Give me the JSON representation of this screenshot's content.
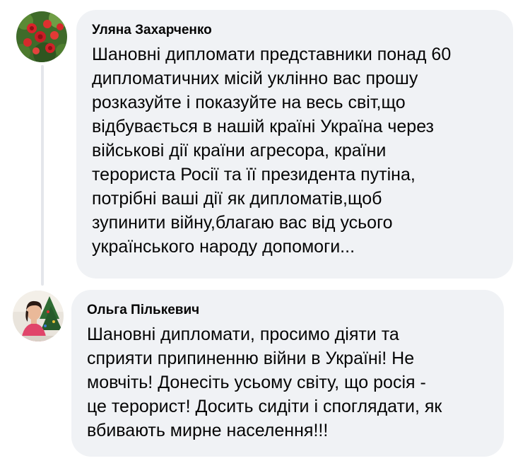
{
  "comments": [
    {
      "author": "Уляна Захарченко",
      "avatar_icon": "roses-photo-avatar",
      "lines": [
        "Шановні дипломати представники понад 60",
        "дипломатичних місій уклінно вас прошу",
        "розказуйте і показуйте на весь світ,що",
        "відбувається в нашій країні Україна через",
        "військові дії країни агресора, країни",
        "терориста Росії та її президента путіна,",
        "потрібні ваші дії як дипломатів,щоб",
        "зупинити війну,благаю вас від усього",
        "українського народу допомоги..."
      ]
    },
    {
      "author": "Ольга Пількевич",
      "avatar_icon": "woman-portrait-avatar",
      "lines": [
        "Шановні дипломати, просимо діяти та",
        "сприяти припиненню війни в Україні! Не",
        "мовчіть! Донесіть усьому світу, що росія -",
        "це терорист! Досить сидіти і споглядати, як",
        "вбивають мирне населення!!!"
      ]
    }
  ],
  "colors": {
    "bubble": "#f0f2f5",
    "text": "#050505",
    "thread_line": "#e4e6eb"
  }
}
